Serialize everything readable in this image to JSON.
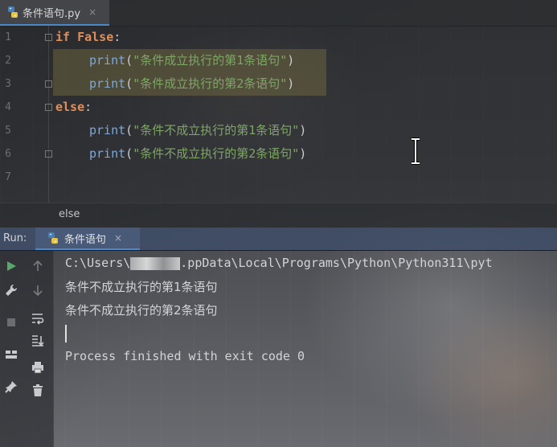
{
  "editor_tab": {
    "filename": "条件语句.py",
    "close": "×"
  },
  "code_lines": [
    {
      "num": "1",
      "kw": "if",
      "rest_kw": "False",
      "tail": ":"
    },
    {
      "num": "2",
      "fn": "print",
      "str": "\"条件成立执行的第1条语句\""
    },
    {
      "num": "3",
      "fn": "print",
      "str": "\"条件成立执行的第2条语句\""
    },
    {
      "num": "4",
      "kw": "else",
      "tail": ":"
    },
    {
      "num": "5",
      "fn": "print",
      "str": "\"条件不成立执行的第1条语句\""
    },
    {
      "num": "6",
      "fn": "print",
      "str": "\"条件不成立执行的第2条语句\""
    },
    {
      "num": "7"
    }
  ],
  "breadcrumb": "else",
  "run_panel": {
    "title": "Run:",
    "tab_label": "条件语句",
    "tab_close": "×",
    "output": {
      "path_prefix": "C:\\Users\\",
      "path_suffix": ".ppData\\Local\\Programs\\Python\\Python311\\pyt",
      "line1": "条件不成立执行的第1条语句",
      "line2": "条件不成立执行的第2条语句",
      "finished": "Process finished with exit code 0"
    }
  },
  "icons": {
    "run": "play-icon",
    "settings": "wrench-icon",
    "stop": "stop-icon",
    "layout": "layout-icon",
    "pin": "pin-icon",
    "up": "arrow-up-icon",
    "down": "arrow-down-icon",
    "wrap": "soft-wrap-icon",
    "scroll_end": "scroll-to-end-icon",
    "print": "print-icon",
    "trash": "trash-icon"
  },
  "colors": {
    "keyword": "#e08e5a",
    "function": "#7fa8d8",
    "string": "#7fa567",
    "accent": "#4a88c7",
    "run_green": "#59a869"
  }
}
